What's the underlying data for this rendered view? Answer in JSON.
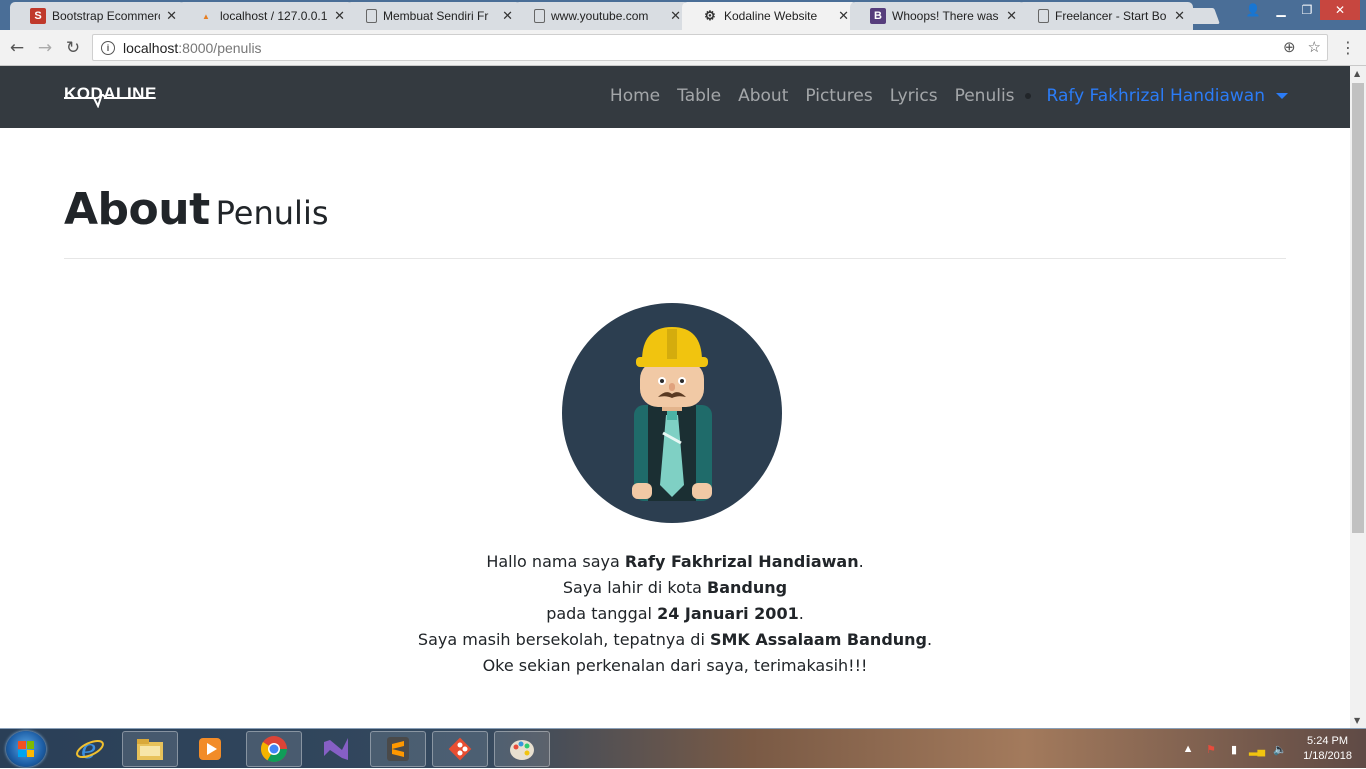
{
  "browser": {
    "tabs": [
      {
        "label": "Bootstrap Ecommerce",
        "icon": "s-red-icon",
        "active": false
      },
      {
        "label": "localhost / 127.0.0.1",
        "icon": "phpmyadmin-icon",
        "active": false
      },
      {
        "label": "Membuat Sendiri Fr",
        "icon": "document-icon",
        "active": false
      },
      {
        "label": "www.youtube.com",
        "icon": "document-icon",
        "active": false
      },
      {
        "label": "Kodaline Website",
        "icon": "kodaline-icon",
        "active": true
      },
      {
        "label": "Whoops! There was",
        "icon": "b-purple-icon",
        "active": false
      },
      {
        "label": "Freelancer - Start Bo",
        "icon": "document-icon",
        "active": false
      }
    ],
    "url_host": "localhost",
    "url_path": ":8000/penulis",
    "info_icon": "i"
  },
  "site": {
    "brand": "KODALINE",
    "nav": {
      "home": "Home",
      "table": "Table",
      "about": "About",
      "pictures": "Pictures",
      "lyrics": "Lyrics",
      "penulis": "Penulis",
      "user": "Rafy Fakhrizal Handiawan"
    },
    "heading_main": "About",
    "heading_sub": "Penulis",
    "bio": {
      "line1_pre": "Hallo nama saya ",
      "line1_bold": "Rafy Fakhrizal Handiawan",
      "line1_post": ".",
      "line2_pre": "Saya lahir di kota ",
      "line2_bold": "Bandung",
      "line3_pre": "pada tanggal ",
      "line3_bold": "24 Januari 2001",
      "line3_post": ".",
      "line4_pre": "Saya masih bersekolah, tepatnya di ",
      "line4_bold": "SMK Assalaam Bandung",
      "line4_post": ".",
      "line5": "Oke sekian perkenalan dari saya, terimakasih!!!"
    }
  },
  "taskbar": {
    "time": "5:24 PM",
    "date": "1/18/2018"
  },
  "colors": {
    "navbar_bg": "#343a40",
    "accent": "#2b7cf7",
    "avatar_bg": "#2c3e50",
    "helmet": "#f1c40f"
  }
}
